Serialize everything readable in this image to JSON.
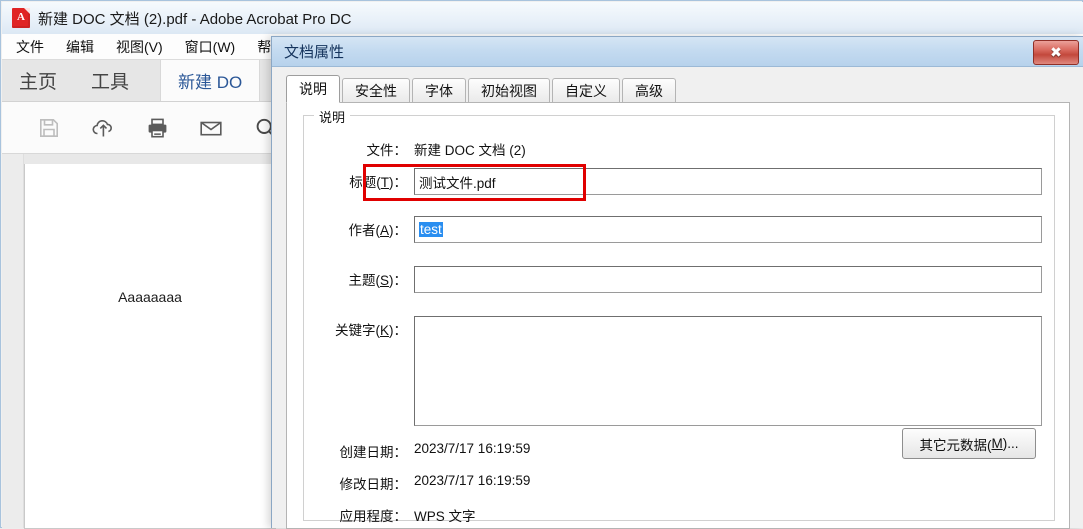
{
  "app": {
    "title": "新建 DOC 文档 (2).pdf - Adobe Acrobat Pro DC",
    "icon": "pdf-document-icon",
    "icon_letter": "A",
    "menu": [
      "文件",
      "编辑",
      "视图(V)",
      "窗口(W)",
      "帮"
    ],
    "tabs": [
      {
        "label": "主页"
      },
      {
        "label": "工具"
      },
      {
        "label": "新建 DO"
      }
    ],
    "toolbar_icons": [
      "save-icon",
      "cloud-upload-icon",
      "print-icon",
      "email-icon",
      "search-icon"
    ],
    "page_text": "Aaaaaaaa"
  },
  "dialog": {
    "title": "文档属性",
    "close_label": "✖",
    "tabs": [
      {
        "label": "说明",
        "active": true
      },
      {
        "label": "安全性",
        "active": false
      },
      {
        "label": "字体",
        "active": false
      },
      {
        "label": "初始视图",
        "active": false
      },
      {
        "label": "自定义",
        "active": false
      },
      {
        "label": "高级",
        "active": false
      }
    ],
    "group_legend": "说明",
    "fields": {
      "file_label": "文件：",
      "file_value": "新建 DOC 文档 (2)",
      "title_label_pre": "标题(",
      "title_label_key": "T",
      "title_label_post": ")：",
      "title_value": "测试文件.pdf",
      "author_label_pre": "作者(",
      "author_label_key": "A",
      "author_label_post": ")：",
      "author_value": "test",
      "author_selected": true,
      "subject_label_pre": "主题(",
      "subject_label_key": "S",
      "subject_label_post": ")：",
      "subject_value": "",
      "keywords_label_pre": "关键字(",
      "keywords_label_key": "K",
      "keywords_label_post": ")：",
      "keywords_value": "",
      "created_label": "创建日期：",
      "created_value": "2023/7/17 16:19:59",
      "modified_label": "修改日期：",
      "modified_value": "2023/7/17 16:19:59",
      "application_label": "应用程度：",
      "application_value": "WPS 文字"
    },
    "meta_button": {
      "text_pre": "其它元数据(",
      "key": "M",
      "text_post": ")..."
    },
    "highlight_color": "#e00000"
  }
}
